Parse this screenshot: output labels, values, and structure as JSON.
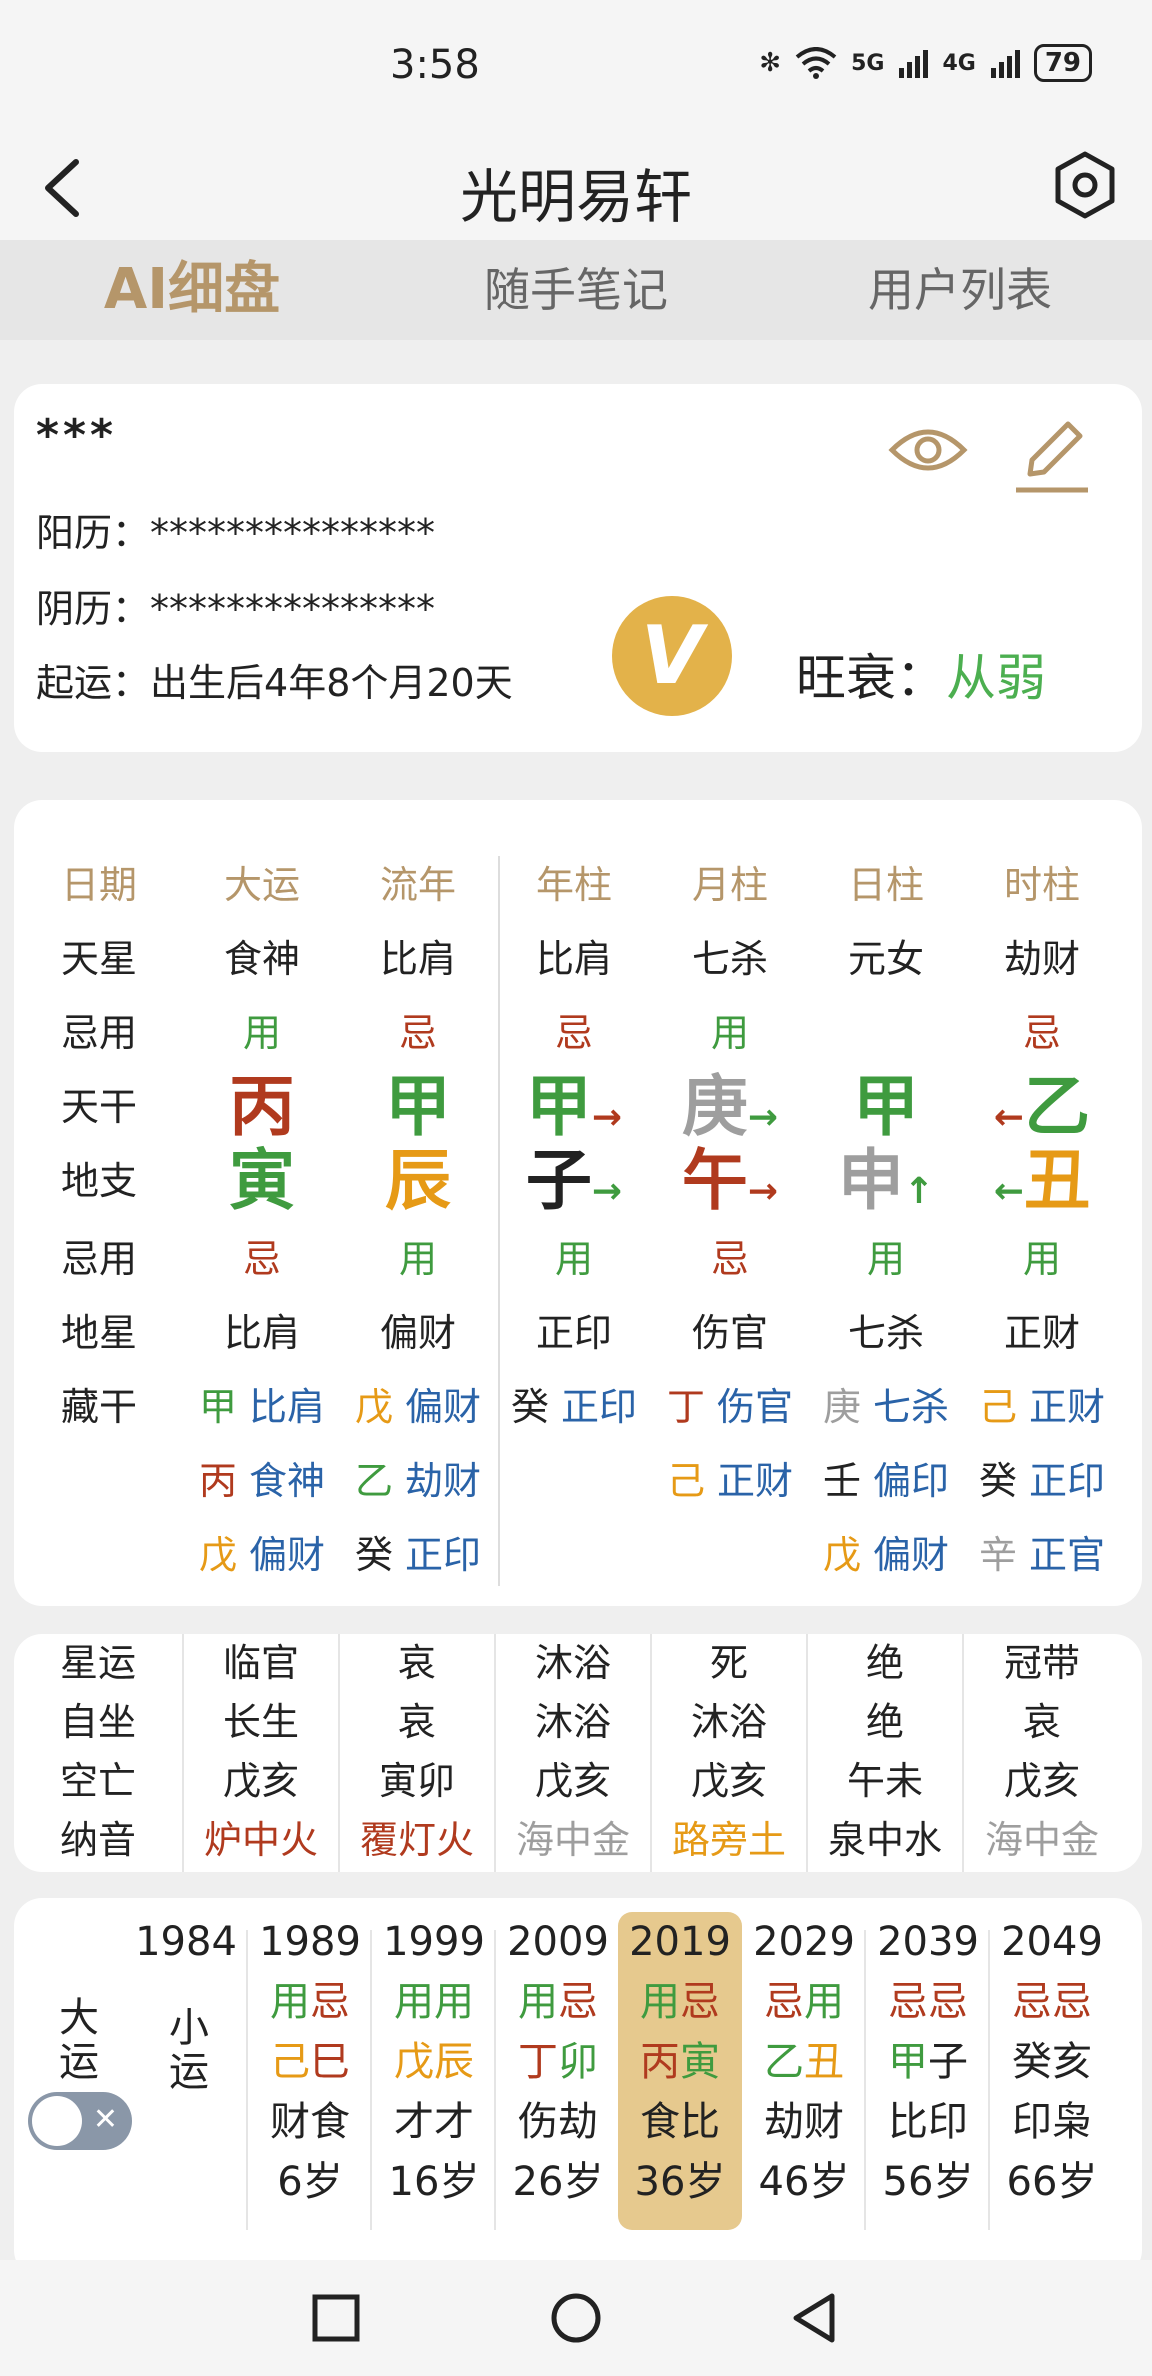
{
  "status": {
    "time": "3:58",
    "bt": "✻",
    "net1": "5G",
    "net2": "4G",
    "battery": "79"
  },
  "app": {
    "title": "光明易轩"
  },
  "tabs": [
    {
      "label": "AI细盘"
    },
    {
      "label": "随手笔记"
    },
    {
      "label": "用户列表"
    }
  ],
  "profile": {
    "name": "***",
    "solar_label": "阳历：",
    "solar_value": "***************",
    "lunar_label": "阴历：",
    "lunar_value": "***************",
    "start_label": "起运：",
    "start_value": "出生后4年8个月20天",
    "vip": "V",
    "strength_label": "旺衰：",
    "strength_value": "从弱"
  },
  "pillars": {
    "headers": [
      "日期",
      "大运",
      "流年",
      "年柱",
      "月柱",
      "日柱",
      "时柱"
    ],
    "tianxing": [
      "天星",
      "食神",
      "比肩",
      "比肩",
      "七杀",
      "元女",
      "劫财"
    ],
    "jiyong1": [
      "忌用",
      "用",
      "忌",
      "忌",
      "用",
      "",
      "忌"
    ],
    "tiangan": [
      "天干",
      "丙",
      "甲",
      "甲",
      "庚",
      "甲",
      "乙"
    ],
    "dizhi": [
      "地支",
      "寅",
      "辰",
      "子",
      "午",
      "申",
      "丑"
    ],
    "jiyong2": [
      "忌用",
      "忌",
      "用",
      "用",
      "忌",
      "用",
      "用"
    ],
    "dixing": [
      "地星",
      "比肩",
      "偏财",
      "正印",
      "伤官",
      "七杀",
      "正财"
    ],
    "canggan_label": "藏干",
    "canggan": [
      [
        {
          "g": "甲",
          "s": "比肩"
        },
        {
          "g": "丙",
          "s": "食神"
        },
        {
          "g": "戊",
          "s": "偏财"
        }
      ],
      [
        {
          "g": "戊",
          "s": "偏财"
        },
        {
          "g": "乙",
          "s": "劫财"
        },
        {
          "g": "癸",
          "s": "正印"
        }
      ],
      [
        {
          "g": "癸",
          "s": "正印"
        }
      ],
      [
        {
          "g": "丁",
          "s": "伤官"
        },
        {
          "g": "己",
          "s": "正财"
        }
      ],
      [
        {
          "g": "庚",
          "s": "七杀"
        },
        {
          "g": "壬",
          "s": "偏印"
        },
        {
          "g": "戊",
          "s": "偏财"
        }
      ],
      [
        {
          "g": "己",
          "s": "正财"
        },
        {
          "g": "癸",
          "s": "正印"
        },
        {
          "g": "辛",
          "s": "正官"
        }
      ]
    ]
  },
  "extra": {
    "labels": [
      "星运",
      "自坐",
      "空亡",
      "纳音"
    ],
    "cols": [
      [
        "临官",
        "长生",
        "戊亥",
        "炉中火"
      ],
      [
        "哀",
        "哀",
        "寅卯",
        "覆灯火"
      ],
      [
        "沐浴",
        "沐浴",
        "戊亥",
        "海中金"
      ],
      [
        "死",
        "沐浴",
        "戊亥",
        "路旁土"
      ],
      [
        "绝",
        "绝",
        "午未",
        "泉中水"
      ],
      [
        "冠带",
        "哀",
        "戊亥",
        "海中金"
      ]
    ]
  },
  "dayun": {
    "label_dayun": "大运",
    "label_xiaoyun": "小运",
    "toggle_x": "✕",
    "years": [
      {
        "year": "1984"
      },
      {
        "year": "1989",
        "jy1": "用",
        "jy2": "忌",
        "g": "己",
        "z": "巳",
        "ss": "财食",
        "age": "6岁"
      },
      {
        "year": "1999",
        "jy1": "用",
        "jy2": "用",
        "g": "戊",
        "z": "辰",
        "ss": "才才",
        "age": "16岁"
      },
      {
        "year": "2009",
        "jy1": "用",
        "jy2": "忌",
        "g": "丁",
        "z": "卯",
        "ss": "伤劫",
        "age": "26岁"
      },
      {
        "year": "2019",
        "jy1": "用",
        "jy2": "忌",
        "g": "丙",
        "z": "寅",
        "ss": "食比",
        "age": "36岁"
      },
      {
        "year": "2029",
        "jy1": "忌",
        "jy2": "用",
        "g": "乙",
        "z": "丑",
        "ss": "劫财",
        "age": "46岁"
      },
      {
        "year": "2039",
        "jy1": "忌",
        "jy2": "忌",
        "g": "甲",
        "z": "子",
        "ss": "比印",
        "age": "56岁"
      },
      {
        "year": "2049",
        "jy1": "忌",
        "jy2": "忌",
        "g": "癸",
        "z": "亥",
        "ss": "印枭",
        "age": "66岁"
      }
    ]
  }
}
